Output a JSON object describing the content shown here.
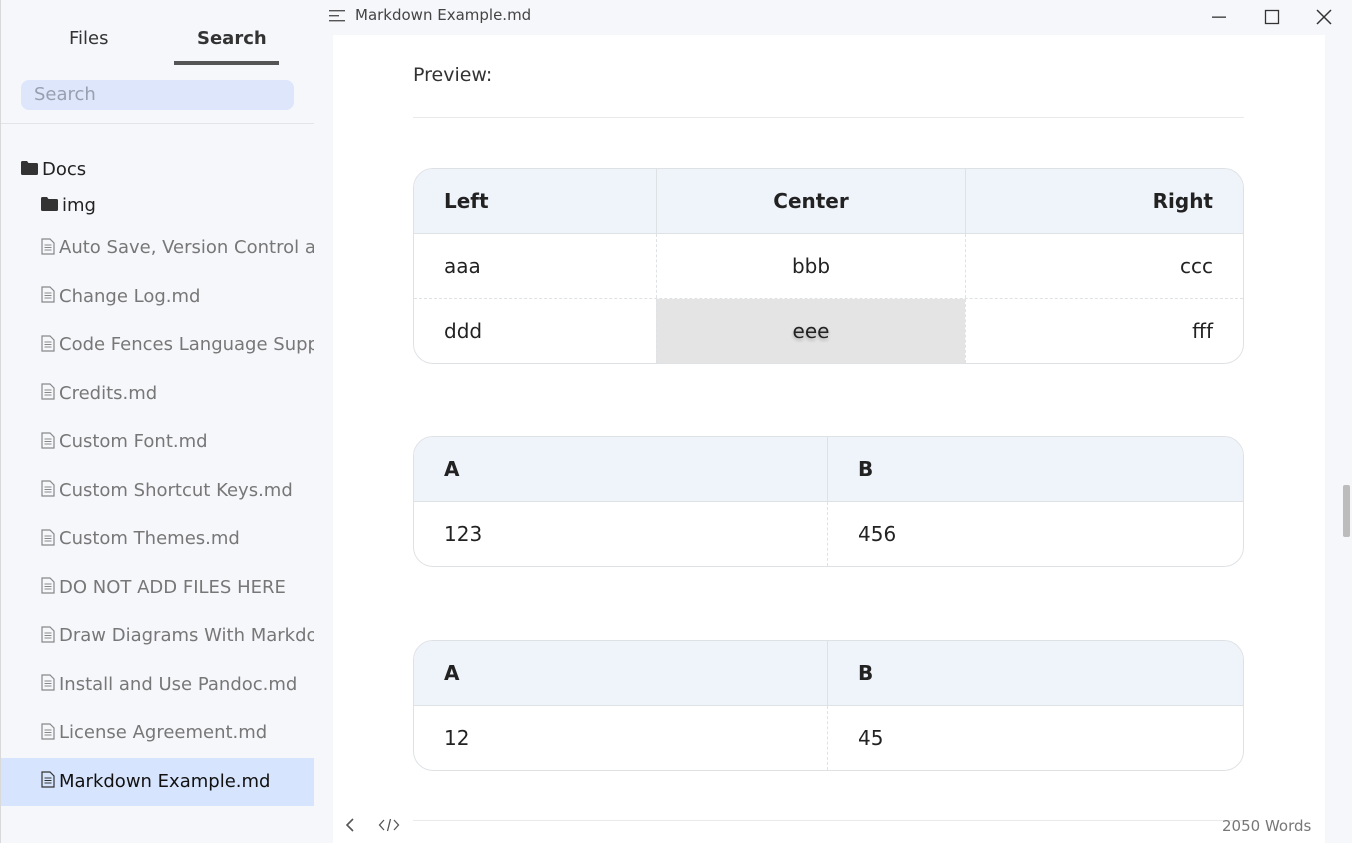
{
  "window": {
    "title": "Markdown Example.md"
  },
  "sidebar": {
    "tabs": [
      {
        "label": "Files"
      },
      {
        "label": "Search"
      }
    ],
    "search": {
      "placeholder": "Search"
    },
    "folders": [
      {
        "label": "Docs"
      },
      {
        "label": "img"
      }
    ],
    "files": [
      {
        "label": "Auto Save, Version Control and Recovery.md"
      },
      {
        "label": "Change Log.md"
      },
      {
        "label": "Code Fences Language Support.md"
      },
      {
        "label": "Credits.md"
      },
      {
        "label": "Custom Font.md"
      },
      {
        "label": "Custom Shortcut Keys.md"
      },
      {
        "label": "Custom Themes.md"
      },
      {
        "label": "DO NOT ADD FILES HERE"
      },
      {
        "label": "Draw Diagrams With Markdown.md"
      },
      {
        "label": "Install and Use Pandoc.md"
      },
      {
        "label": "License Agreement.md"
      },
      {
        "label": "Markdown Example.md"
      }
    ]
  },
  "main": {
    "preview_label": "Preview:",
    "table1": {
      "headers": [
        "Left",
        "Center",
        "Right"
      ],
      "rows": [
        [
          "aaa",
          "bbb",
          "ccc"
        ],
        [
          "ddd",
          "eee",
          "fff"
        ]
      ]
    },
    "table2": {
      "headers": [
        "A",
        "B"
      ],
      "rows": [
        [
          "123",
          "456"
        ]
      ]
    },
    "table3": {
      "headers": [
        "A",
        "B"
      ],
      "rows": [
        [
          "12",
          "45"
        ]
      ]
    }
  },
  "footer": {
    "word_count": "2050 Words"
  },
  "colors": {
    "active_item": "#d6e4fd",
    "search_bg": "#dde6fb",
    "table_header": "#eff3fa"
  }
}
